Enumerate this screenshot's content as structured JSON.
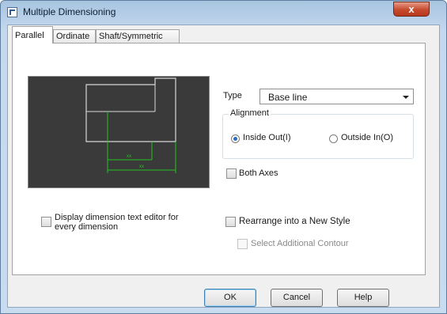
{
  "window": {
    "title": "Multiple Dimensioning",
    "close_label": "x"
  },
  "tabs": [
    {
      "label": "Parallel",
      "active": true
    },
    {
      "label": "Ordinate",
      "active": false
    },
    {
      "label": "Shaft/Symmetric",
      "active": false
    }
  ],
  "preview": {
    "outline_color": "#d8d8d8",
    "dimension_color": "#22c322",
    "background_color": "#3a3a3a",
    "dim_label_1": "xx",
    "dim_label_2": "xx"
  },
  "type": {
    "label": "Type",
    "value": "Base line"
  },
  "alignment": {
    "legend": "Alignment",
    "options": [
      {
        "label": "Inside Out(I)",
        "checked": true
      },
      {
        "label": "Outside In(O)",
        "checked": false
      }
    ]
  },
  "both_axes": {
    "label": "Both Axes",
    "checked": false
  },
  "display_editor": {
    "label_line1": "Display dimension text editor for",
    "label_line2": "every dimension",
    "checked": false
  },
  "rearrange": {
    "label": "Rearrange into a New Style",
    "checked": false
  },
  "select_contour": {
    "label": "Select Additional Contour",
    "checked": false,
    "enabled": false
  },
  "buttons": {
    "ok": "OK",
    "cancel": "Cancel",
    "help": "Help"
  }
}
